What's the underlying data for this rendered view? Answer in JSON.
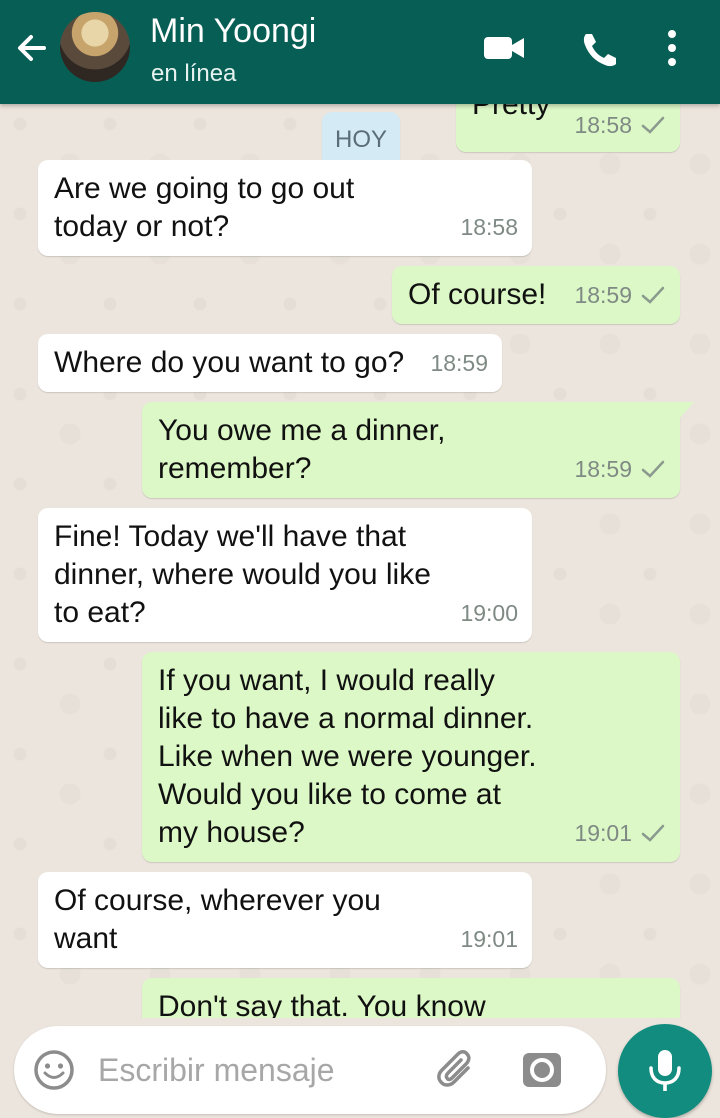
{
  "header": {
    "contact_name": "Min Yoongi",
    "status": "en línea",
    "icons": [
      "back-arrow-icon",
      "video-call-icon",
      "phone-icon",
      "more-vertical-icon"
    ]
  },
  "chat": {
    "date_chip": "HOY",
    "messages": [
      {
        "dir": "out",
        "text": "Pretty",
        "time": "18:58",
        "receipt": "single-check-icon"
      },
      {
        "dir": "in",
        "text": "Are we going to go out today or not?",
        "time": "18:58"
      },
      {
        "dir": "out",
        "text": "Of course!",
        "time": "18:59",
        "receipt": "single-check-icon"
      },
      {
        "dir": "in",
        "text": "Where do you want to go?",
        "time": "18:59"
      },
      {
        "dir": "out",
        "text": "You owe me a dinner, remember?",
        "time": "18:59",
        "receipt": "single-check-icon"
      },
      {
        "dir": "in",
        "text": "Fine! Today we'll have that dinner, where would you like to eat?",
        "time": "19:00"
      },
      {
        "dir": "out",
        "text": "If you want, I would really like to have a normal dinner. Like when we were younger. Would you like to come at my house?",
        "time": "19:01",
        "receipt": "single-check-icon"
      },
      {
        "dir": "in",
        "text": "Of course, wherever you want",
        "time": "19:01"
      },
      {
        "dir": "out",
        "text": "Don't say that. You know",
        "time": "",
        "receipt": ""
      }
    ]
  },
  "composer": {
    "placeholder": "Escribir mensaje",
    "icons": [
      "emoji-icon",
      "attach-icon",
      "camera-icon",
      "mic-icon"
    ]
  },
  "colors": {
    "header": "#075e54",
    "outgoing_bubble": "#dcf8c6",
    "incoming_bubble": "#ffffff",
    "date_chip": "#d4eaf4",
    "fab": "#128c7e",
    "wallpaper": "#ece5dd"
  }
}
